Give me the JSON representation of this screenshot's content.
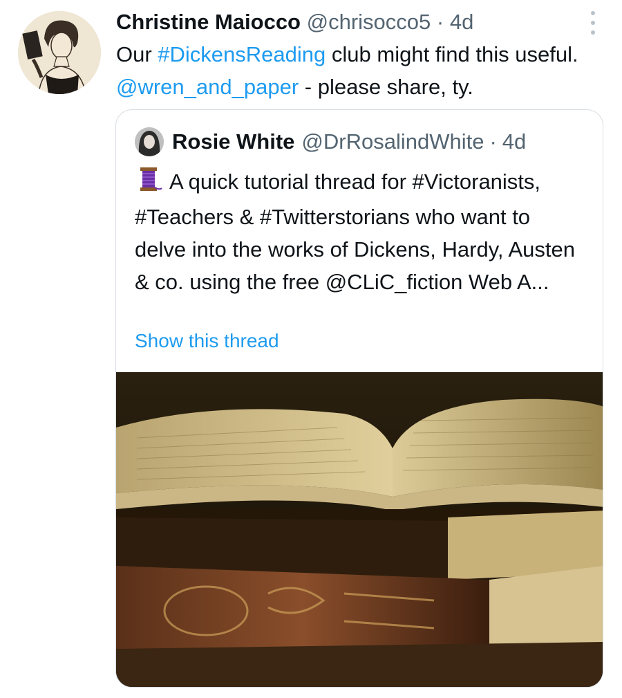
{
  "tweet": {
    "author_name": "Christine Maiocco",
    "author_handle": "@chrisocco5",
    "separator": "·",
    "time": "4d",
    "text_1": "Our ",
    "hashtag": "#DickensReading",
    "text_2": " club might find this useful. ",
    "mention": "@wren_and_paper",
    "text_3": " - please share, ty.",
    "more_icon": "more-vertical-icon"
  },
  "quoted_tweet": {
    "author_name": "Rosie White",
    "author_handle": "@DrRosalindWhite",
    "separator": "·",
    "time": "4d",
    "emoji_icon": "thread-spool-icon",
    "text": "A quick tutorial thread for #Victoranists, #Teachers & #Twitterstorians who want to delve into the works of Dickens, Hardy, Austen & co. using the free @CLiC_fiction Web A...",
    "show_thread": "Show this thread",
    "image": "photo of old open book on stacked antique books"
  },
  "colors": {
    "link": "#1d9bf0",
    "text": "#0f1419",
    "meta": "#536471",
    "border": "#d7dde2"
  }
}
